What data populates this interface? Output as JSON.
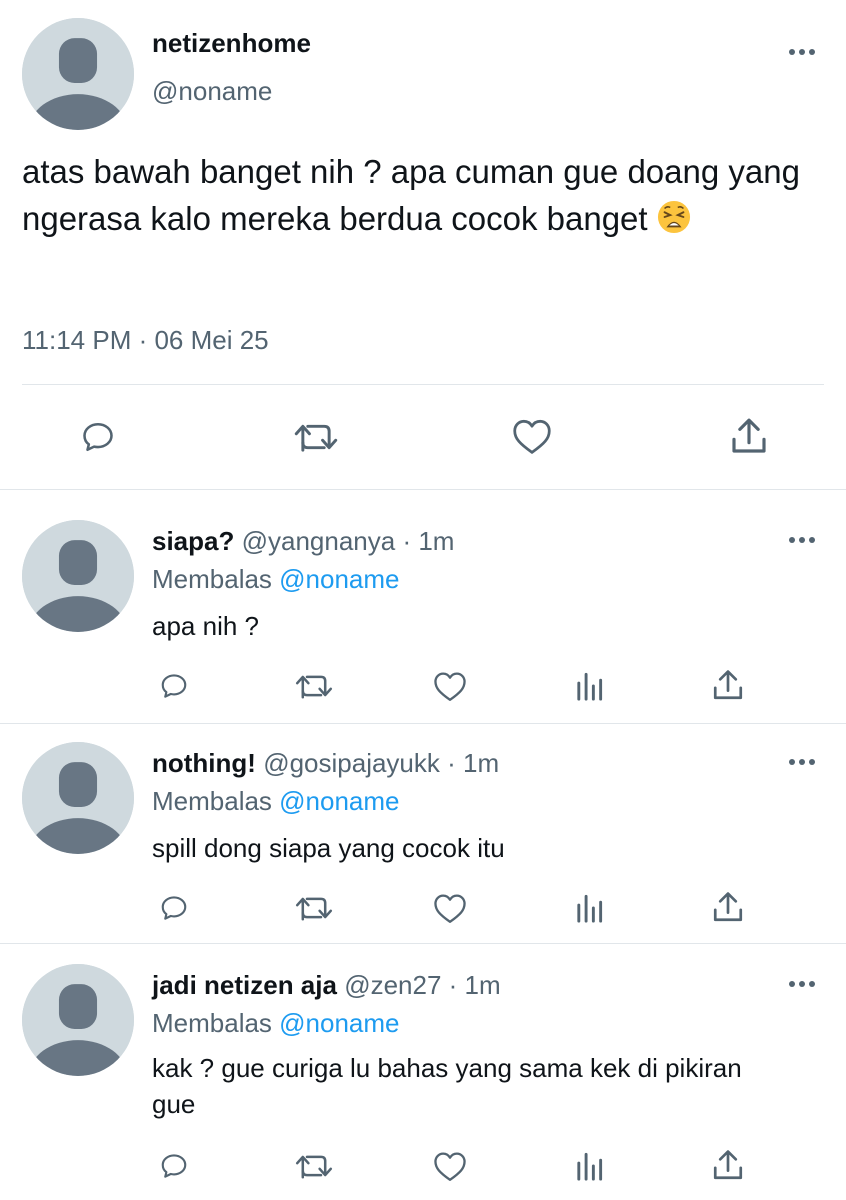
{
  "tweet": {
    "display_name": "netizenhome",
    "handle": "@noname",
    "text": "atas bawah banget nih ? apa cuman gue doang yang ngerasa kalo mereka berdua cocok banget",
    "emoji": "weary-face",
    "timestamp": "11:14 PM · 06 Mei 25",
    "actions": [
      "reply-icon",
      "retweet-icon",
      "like-icon",
      "share-icon"
    ]
  },
  "replies": [
    {
      "display_name": "siapa?",
      "meta": "@yangnanya · 1m",
      "replying_prefix": "Membalas ",
      "replying_to": "@noname",
      "text": "apa nih ?"
    },
    {
      "display_name": "nothing!",
      "meta": "@gosipajayukk · 1m",
      "replying_prefix": "Membalas ",
      "replying_to": "@noname",
      "text": "spill dong siapa yang cocok itu"
    },
    {
      "display_name": "jadi netizen aja",
      "meta": "@zen27 · 1m",
      "replying_prefix": "Membalas ",
      "replying_to": "@noname",
      "text": "kak ? gue curiga lu bahas yang sama kek di pikiran gue"
    }
  ],
  "colors": {
    "text": "#0f1419",
    "secondary": "#536471",
    "accent": "#1d9bf0",
    "divider": "#e1e6ea",
    "avatar_bg": "#cfd9de",
    "avatar_fg": "#687684"
  }
}
